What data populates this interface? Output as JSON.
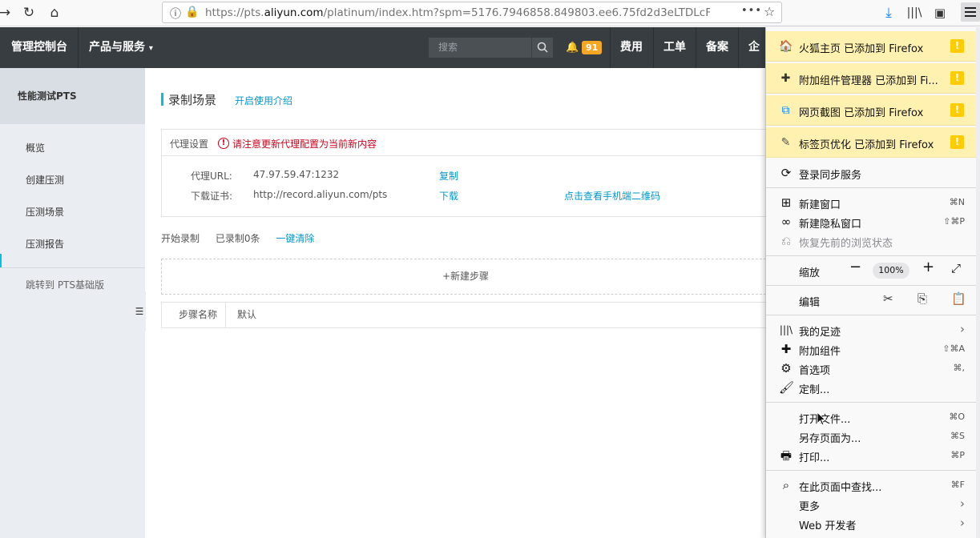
{
  "browser": {
    "url_prefix": "https://pts.",
    "url_domain": "aliyun.com",
    "url_rest": "/platinum/index.htm?spm=5176.7946858.849803.ee6.75fd2d3eLTDLcF#/Sc",
    "menu_dots": "•••"
  },
  "console": {
    "home": "管理控制台",
    "products": "产品与服务",
    "search_placeholder": "搜索",
    "notif_count": "91",
    "fees": "费用",
    "tickets": "工单",
    "icp": "备案",
    "enterprise": "企业"
  },
  "sidebar": {
    "title": "性能测试PTS",
    "items": [
      {
        "label": "概览"
      },
      {
        "label": "创建压测"
      },
      {
        "label": "压测场景"
      },
      {
        "label": "压测报告"
      }
    ],
    "extra": "跳转到 PTS基础版"
  },
  "main": {
    "title": "录制场景",
    "intro_link": "开启使用介绍",
    "proxy": {
      "title": "代理设置",
      "warning": "请注意更新代理配置为当前新内容",
      "url_label": "代理URL:",
      "url_value": "47.97.59.47:1232",
      "copy": "复制",
      "cert_label": "下载证书:",
      "cert_value": "http://record.aliyun.com/pts",
      "download": "下载",
      "qr": "点击查看手机端二维码"
    },
    "actions": {
      "start": "开始录制",
      "recorded": "已录制0条",
      "clear": "一键清除"
    },
    "new_step": "+新建步骤",
    "table": {
      "col_name": "步骤名称",
      "col_default": "默认"
    }
  },
  "ff_menu": {
    "notices": [
      {
        "icon": "fox-home-icon",
        "text": "火狐主页 已添加到 Firefox"
      },
      {
        "icon": "addon-manager-icon",
        "text": "附加组件管理器 已添加到 Fi..."
      },
      {
        "icon": "screenshot-icon",
        "text": "网页截图 已添加到 Firefox"
      },
      {
        "icon": "tab-optimize-icon",
        "text": "标签页优化 已添加到 Firefox"
      }
    ],
    "sync": "登录同步服务",
    "new_window": "新建窗口",
    "new_window_sc": "⌘N",
    "private_window": "新建隐私窗口",
    "private_window_sc": "⇧⌘P",
    "restore": "恢复先前的浏览状态",
    "zoom": "缩放",
    "zoom_value": "100%",
    "edit": "编辑",
    "library": "我的足迹",
    "addons": "附加组件",
    "addons_sc": "⇧⌘A",
    "prefs": "首选项",
    "prefs_sc": "⌘,",
    "customize": "定制...",
    "open_file": "打开文件...",
    "open_file_sc": "⌘O",
    "save_as": "另存页面为...",
    "save_as_sc": "⌘S",
    "print": "打印...",
    "print_sc": "⌘P",
    "find": "在此页面中查找...",
    "find_sc": "⌘F",
    "more": "更多",
    "webdev": "Web 开发者"
  }
}
